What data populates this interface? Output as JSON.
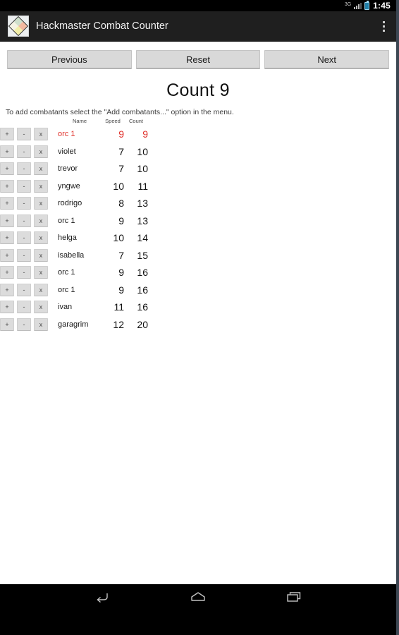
{
  "status_bar": {
    "network_label": "3G",
    "signal_icon": "signal-bars-icon",
    "battery_icon": "battery-icon",
    "clock": "1:45"
  },
  "action_bar": {
    "app_icon": "diamond-logo-icon",
    "title": "Hackmaster Combat Counter",
    "overflow_icon": "overflow-menu-icon"
  },
  "toolbar": {
    "previous_label": "Previous",
    "reset_label": "Reset",
    "next_label": "Next"
  },
  "main": {
    "count_title": "Count 9",
    "instructions": "To add combatants select the \"Add combatants...\" option in the menu."
  },
  "table": {
    "headers": {
      "name": "Name",
      "speed": "Speed",
      "count": "Count"
    },
    "row_buttons": {
      "increment": "+",
      "decrement": "-",
      "remove": "x"
    },
    "active_color": "#e0302a",
    "rows": [
      {
        "name": "orc 1",
        "speed": "9",
        "count": "9",
        "active": true
      },
      {
        "name": "violet",
        "speed": "7",
        "count": "10",
        "active": false
      },
      {
        "name": "trevor",
        "speed": "7",
        "count": "10",
        "active": false
      },
      {
        "name": "yngwe",
        "speed": "10",
        "count": "11",
        "active": false
      },
      {
        "name": "rodrigo",
        "speed": "8",
        "count": "13",
        "active": false
      },
      {
        "name": "orc 1",
        "speed": "9",
        "count": "13",
        "active": false
      },
      {
        "name": "helga",
        "speed": "10",
        "count": "14",
        "active": false
      },
      {
        "name": "isabella",
        "speed": "7",
        "count": "15",
        "active": false
      },
      {
        "name": "orc 1",
        "speed": "9",
        "count": "16",
        "active": false
      },
      {
        "name": "orc 1",
        "speed": "9",
        "count": "16",
        "active": false
      },
      {
        "name": "ivan",
        "speed": "11",
        "count": "16",
        "active": false
      },
      {
        "name": "garagrim",
        "speed": "12",
        "count": "20",
        "active": false
      }
    ]
  },
  "nav_bar": {
    "back_icon": "back-arrow-icon",
    "home_icon": "home-icon",
    "recents_icon": "recent-apps-icon"
  }
}
